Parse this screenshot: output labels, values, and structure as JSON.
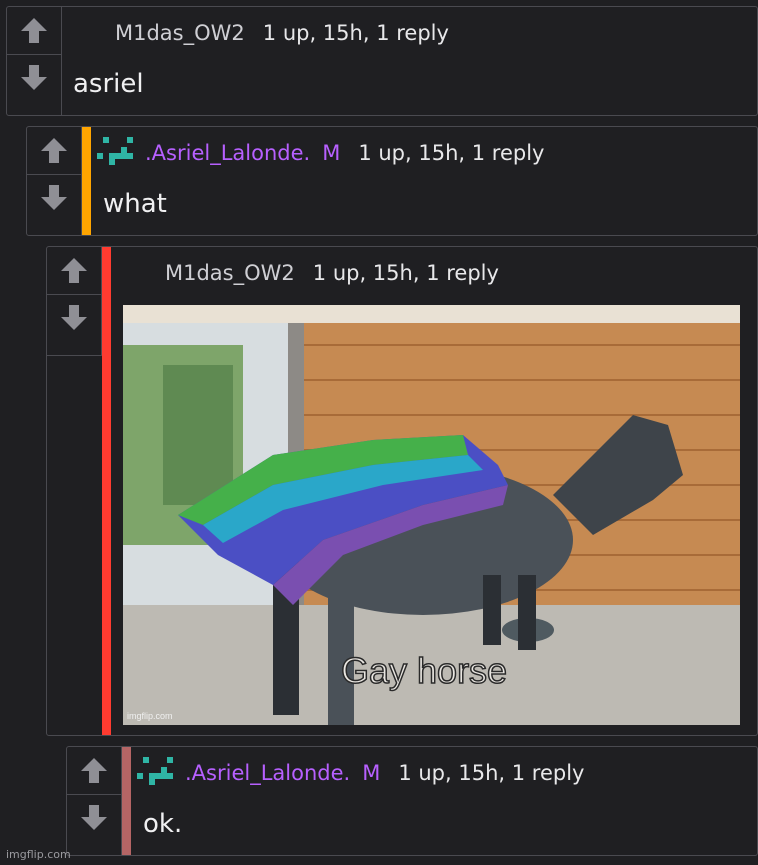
{
  "comments": [
    {
      "username": "M1das_OW2",
      "stats": "1 up, 15h, 1 reply",
      "text": "asriel"
    },
    {
      "username": ".Asriel_Lalonde.",
      "mod_badge": "M",
      "stats": "1 up, 15h, 1 reply",
      "text": "what",
      "stripe_color": "#ffa500"
    },
    {
      "username": "M1das_OW2",
      "stats": "1 up, 15h, 1 reply",
      "image_caption": "Gay horse",
      "image_watermark": "imgflip.com",
      "stripe_color": "#ff3b30"
    },
    {
      "username": ".Asriel_Lalonde.",
      "mod_badge": "M",
      "stats": "1 up, 15h, 1 reply",
      "text": "ok.",
      "stripe_color": "#b56565"
    }
  ],
  "footer": {
    "logo": "imgflip.com"
  },
  "icons": {
    "upvote": "arrow-up-icon",
    "downvote": "arrow-down-icon",
    "avatar": "pixel-avatar-icon"
  }
}
